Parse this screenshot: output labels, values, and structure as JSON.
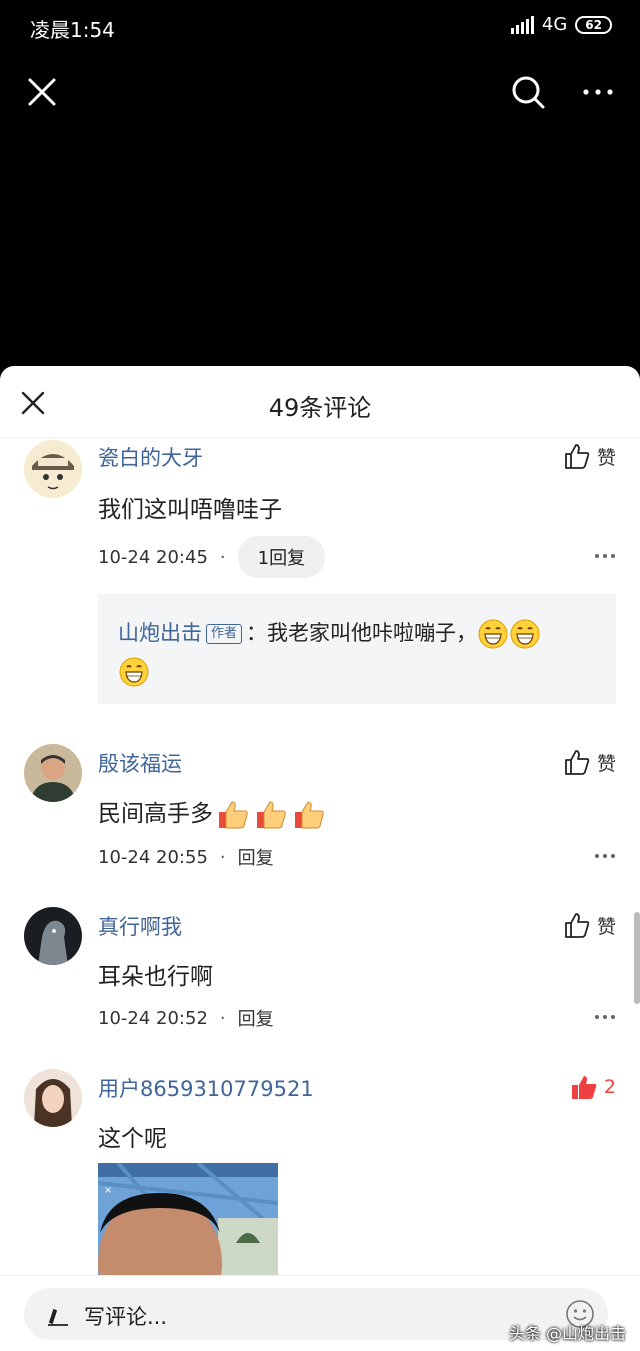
{
  "status_bar": {
    "time": "凌晨1:54",
    "network": "4G",
    "battery": "62"
  },
  "sheet": {
    "title": "49条评论"
  },
  "comments": [
    {
      "username": "瓷白的大牙",
      "text": "我们这叫唔噜哇子",
      "time": "10-24 20:45",
      "reply_label": "1回复",
      "like_label": "赞",
      "reply": {
        "name": "山炮出击",
        "author_tag": "作者",
        "text": "：我老家叫他咔啦嘣子，"
      }
    },
    {
      "username": "殷该福运",
      "text": "民间高手多",
      "time": "10-24 20:55",
      "reply_label": "回复",
      "like_label": "赞"
    },
    {
      "username": "真行啊我",
      "text": "耳朵也行啊",
      "time": "10-24 20:52",
      "reply_label": "回复",
      "like_label": "赞"
    },
    {
      "username": "用户8659310779521",
      "text": "这个呢",
      "like_count": "2"
    }
  ],
  "bottom": {
    "write_label": "写评论...",
    "watermark": "头条 @山炮出击"
  },
  "colors": {
    "link": "#406599",
    "liked": "#f04142",
    "sheet_bg": "#ffffff"
  },
  "icons": [
    "close-icon",
    "search-icon",
    "more-icon",
    "like-icon",
    "liked-icon",
    "pencil-icon",
    "smile-icon",
    "grin-emoji",
    "thumbs-up-emoji"
  ]
}
